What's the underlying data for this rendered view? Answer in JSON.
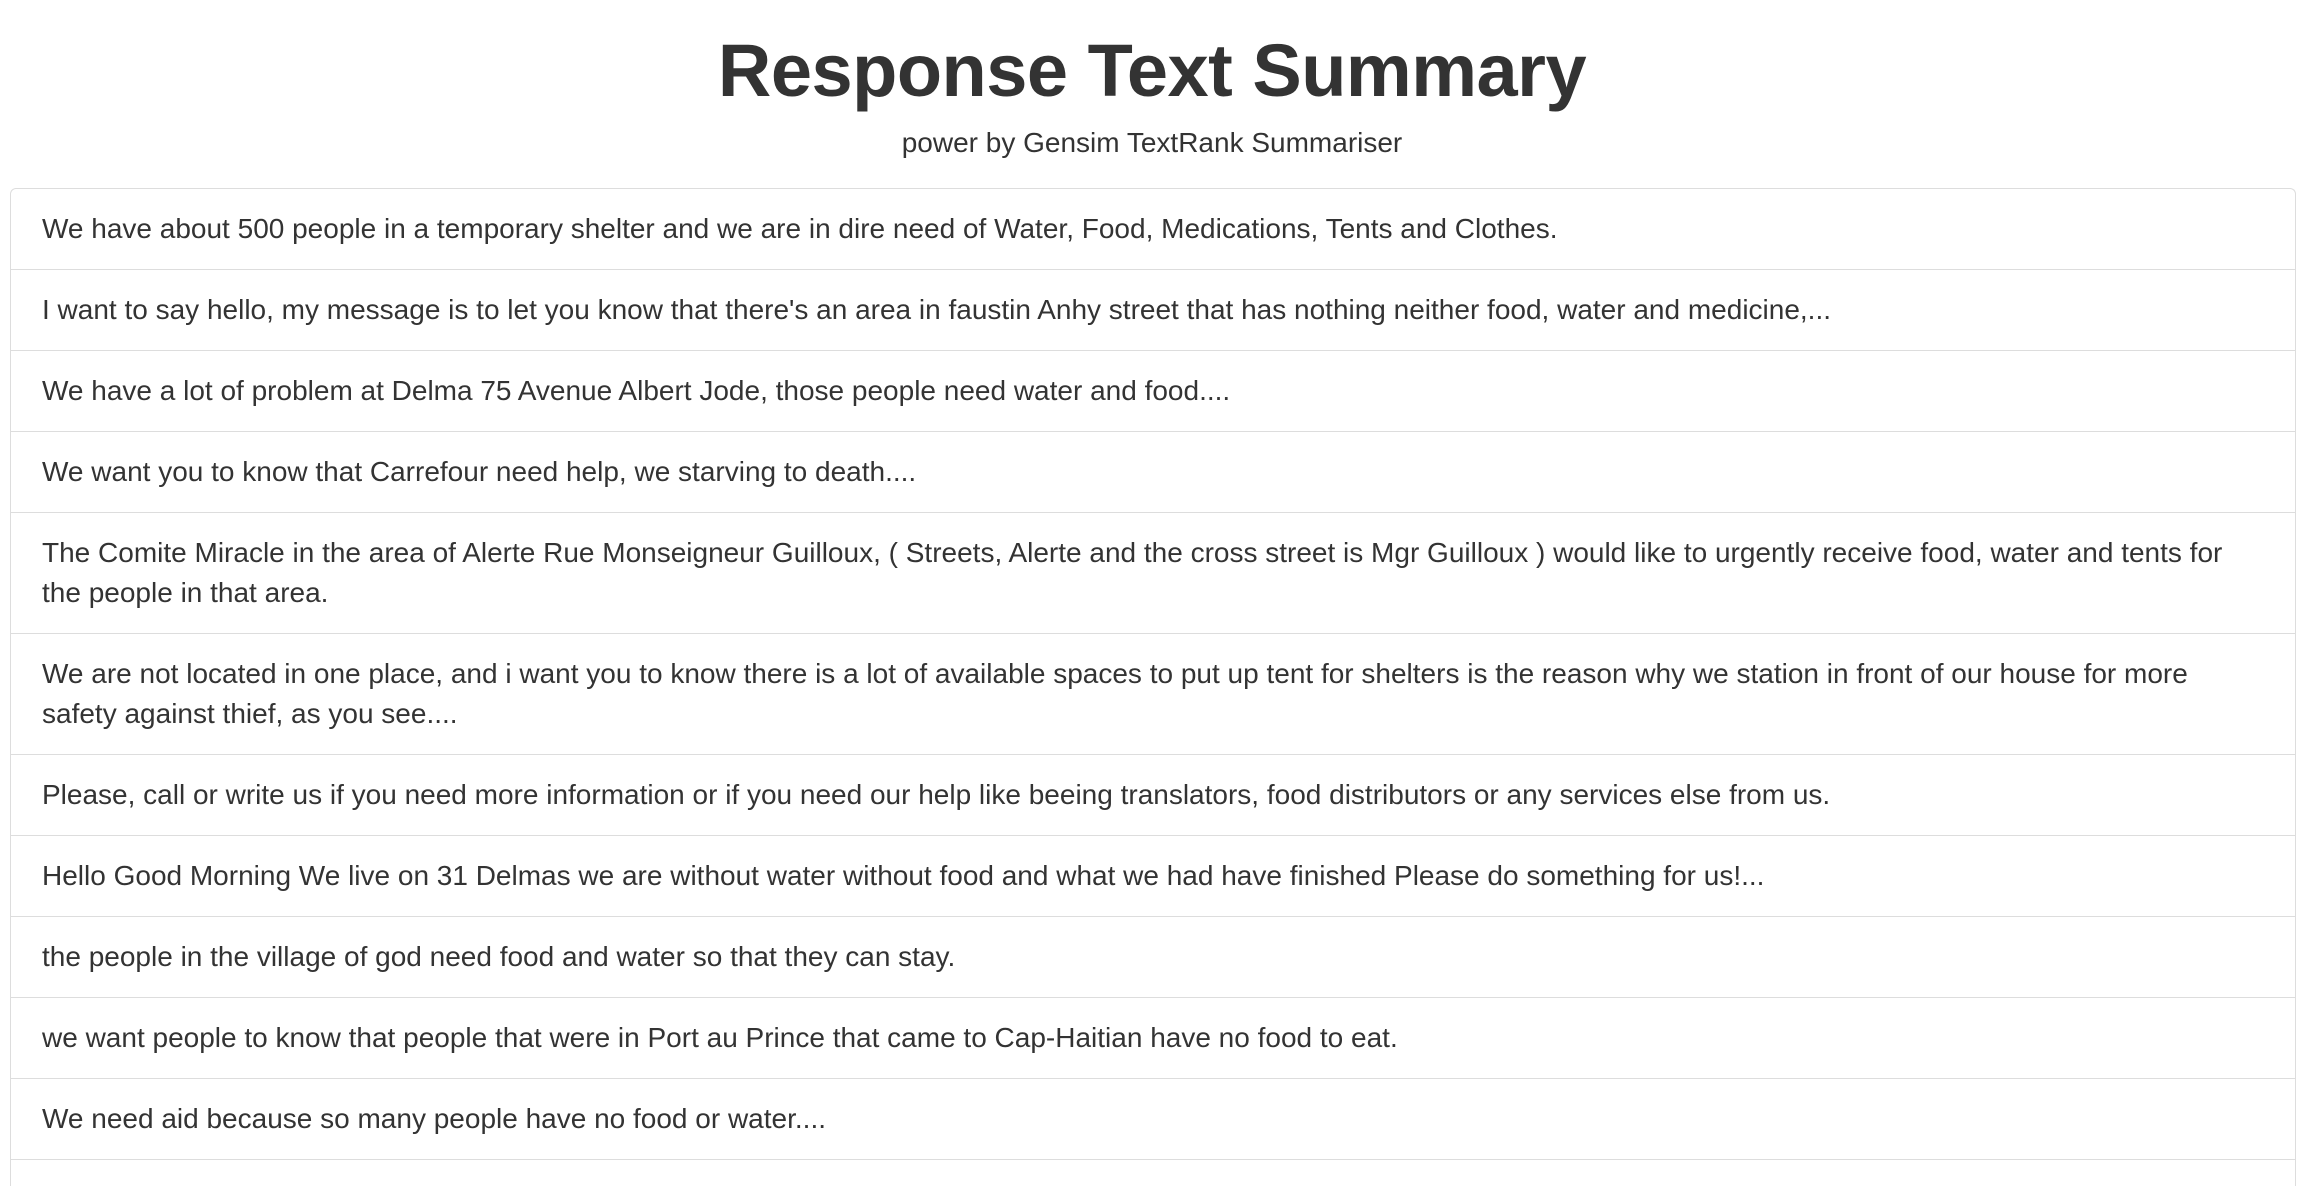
{
  "header": {
    "title": "Response Text Summary",
    "subtitle": "power by Gensim TextRank Summariser"
  },
  "summaries": [
    "We have about 500 people in a temporary shelter and we are in dire need of Water, Food, Medications, Tents and Clothes.",
    "I want to say hello, my message is to let you know that there's an area in faustin Anhy street that has nothing neither food, water and medicine,...",
    "We have a lot of problem at Delma 75 Avenue Albert Jode, those people need water and food....",
    "We want you to know that Carrefour need help, we starving to death....",
    "The Comite Miracle in the area of Alerte Rue Monseigneur Guilloux, ( Streets, Alerte and the cross street is Mgr Guilloux ) would like to urgently receive food, water and tents for the people in that area.",
    "We are not located in one place, and i want you to know there is a lot of available spaces to put up tent for shelters is the reason why we station in front of our house for more safety against thief, as you see....",
    "Please, call or write us if you need more information or if you need our help like beeing translators, food distributors or any services else from us.",
    "Hello Good Morning We live on 31 Delmas we are without water without food and what we had have finished Please do something for us!...",
    "the people in the village of god need food and water so that they can stay.",
    "we want people to know that people that were in Port au Prince that came to Cap-Haitian have no food to eat.",
    "We need aid because so many people have no food or water....",
    ""
  ]
}
